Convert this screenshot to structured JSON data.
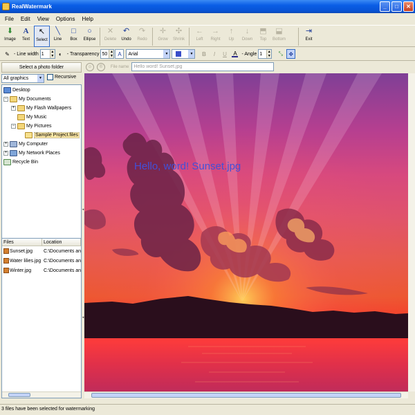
{
  "window": {
    "title": "RealWatermark"
  },
  "menu": [
    "File",
    "Edit",
    "View",
    "Options",
    "Help"
  ],
  "toolbar": {
    "image": "Image",
    "text": "Text",
    "select": "Select",
    "line": "Line",
    "box": "Box",
    "ellipse": "Ellipse",
    "delete": "Delete",
    "undo": "Undo",
    "redo": "Redo",
    "grow": "Grow",
    "shrink": "Shrink",
    "left": "Left",
    "right": "Right",
    "up": "Up",
    "down": "Down",
    "top": "Top",
    "bottom": "Bottom",
    "exit": "Exit"
  },
  "format": {
    "line_width_label": "- Line width",
    "line_width_value": "1",
    "transparency_label": "- Transparency",
    "transparency_value": "50",
    "font": "Arial",
    "angle_label": "- Angle",
    "angle_value": "1",
    "color": "#3a4ec9"
  },
  "left": {
    "select_folder": "Select a photo folder",
    "filter": "All graphics",
    "recursive": "Recursive",
    "tree": {
      "desktop": "Desktop",
      "my_documents": "My Documents",
      "flash_wallpapers": "My Flash Wallpapers",
      "my_music": "My Music",
      "my_pictures": "My Pictures",
      "sample_project": "Sample Project.files",
      "my_computer": "My Computer",
      "network_places": "My Network Places",
      "recycle_bin": "Recycle Bin"
    },
    "files_header": {
      "files": "Files",
      "location": "Location"
    },
    "files": [
      {
        "name": "Sunset.jpg",
        "location": "C:\\Documents and"
      },
      {
        "name": "Water lilies.jpg",
        "location": "C:\\Documents and"
      },
      {
        "name": "Winter.jpg",
        "location": "C:\\Documents and"
      }
    ]
  },
  "preview": {
    "file_name_label": "File name",
    "watermark_field": "Hello word! Sunset.jpg",
    "watermark_text": "Hello, word! Sunset.jpg"
  },
  "status": "3 files have been selected for watermarking"
}
